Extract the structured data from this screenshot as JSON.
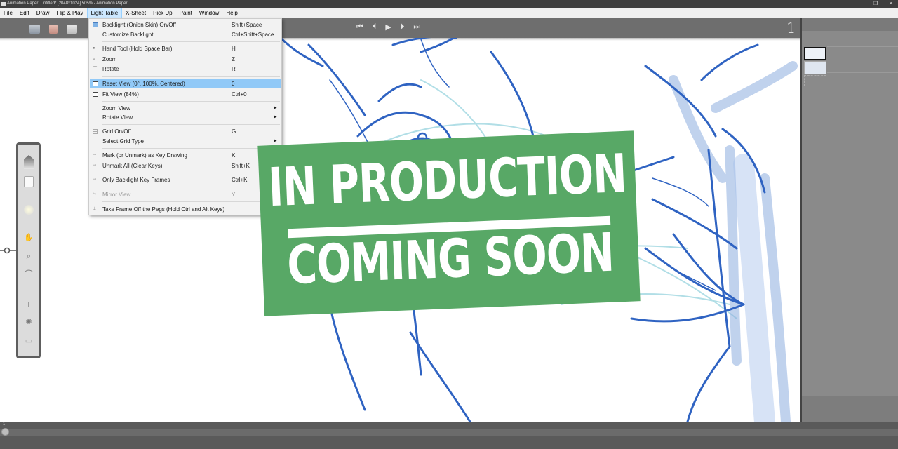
{
  "window": {
    "title": "Animation Paper: Untitled* [2048x1024] 505% - Animation Paper",
    "controls": [
      "–",
      "❐",
      "✕"
    ]
  },
  "menubar": {
    "items": [
      "File",
      "Edit",
      "Draw",
      "Flip & Play",
      "Light Table",
      "X-Sheet",
      "Pick Up",
      "Paint",
      "Window",
      "Help"
    ],
    "active": "Light Table"
  },
  "player": {
    "buttons": [
      "⏮",
      "⏴",
      "▶",
      "⏵",
      "⏭"
    ],
    "frame_number": "1"
  },
  "light_table_menu": {
    "items": [
      {
        "label": "Backlight (Onion Skin) On/Off",
        "shortcut": "Shift+Space",
        "icon": "backlight-icon"
      },
      {
        "label": "Customize Backlight...",
        "shortcut": "Ctrl+Shift+Space"
      },
      {
        "label": "Hand Tool (Hold Space Bar)",
        "shortcut": "H",
        "icon": "hand-icon"
      },
      {
        "label": "Zoom",
        "shortcut": "Z",
        "icon": "zoom-icon"
      },
      {
        "label": "Rotate",
        "shortcut": "R",
        "icon": "rotate-icon"
      },
      {
        "label": "Reset View (0°, 100%, Centered)",
        "shortcut": "0",
        "icon": "reset-view-icon",
        "highlighted": true
      },
      {
        "label": "Fit View (84%)",
        "shortcut": "Ctrl+0",
        "icon": "fit-view-icon"
      },
      {
        "label": "Zoom View",
        "submenu": true
      },
      {
        "label": "Rotate View",
        "submenu": true
      },
      {
        "label": "Grid On/Off",
        "shortcut": "G",
        "icon": "grid-icon"
      },
      {
        "label": "Select Grid Type",
        "submenu": true
      },
      {
        "label": "Mark (or Unmark) as Key Drawing",
        "shortcut": "K",
        "icon": "key-mark-icon"
      },
      {
        "label": "Unmark All (Clear Keys)",
        "shortcut": "Shift+K",
        "icon": "unmark-icon"
      },
      {
        "label": "Only Backlight Key Frames",
        "shortcut": "Ctrl+K",
        "icon": "key-backlight-icon"
      },
      {
        "label": "Mirror View",
        "shortcut": "Y",
        "icon": "mirror-icon",
        "disabled": true
      },
      {
        "label": "Take Frame Off the Pegs (Hold Ctrl and Alt Keys)",
        "icon": "pegs-icon"
      }
    ]
  },
  "banner": {
    "line1": "IN PRODUCTION",
    "line2": "COMING SOON",
    "color": "#58a866"
  },
  "colors": {
    "menu_highlight": "#91c9f7",
    "sketch_blue": "#2f63c2",
    "sketch_light": "#9fd8e0"
  }
}
